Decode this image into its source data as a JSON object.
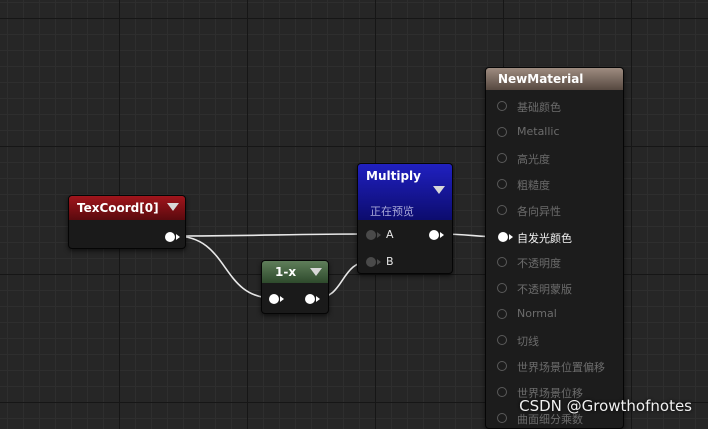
{
  "nodes": {
    "texcoord": {
      "title": "TexCoord[0]"
    },
    "one_minus": {
      "title": "1-x"
    },
    "multiply": {
      "title": "Multiply",
      "subtitle": "正在预览",
      "input_a": "A",
      "input_b": "B"
    },
    "material": {
      "title": "NewMaterial",
      "inputs": [
        "基础颜色",
        "Metallic",
        "高光度",
        "粗糙度",
        "各向异性",
        "自发光颜色",
        "不透明度",
        "不透明蒙版",
        "Normal",
        "切线",
        "世界场景位置偏移",
        "世界场景位移",
        "曲面细分乘数"
      ],
      "active_input": "自发光颜色"
    }
  },
  "colors": {
    "texcoord_header": "#8c1219",
    "one_minus_header": "#4e6b4a",
    "multiply_header": "#1818a8",
    "material_header": "#8a7a70",
    "wire": "#e8e8e8"
  },
  "watermark": "CSDN @Growthofnotes"
}
